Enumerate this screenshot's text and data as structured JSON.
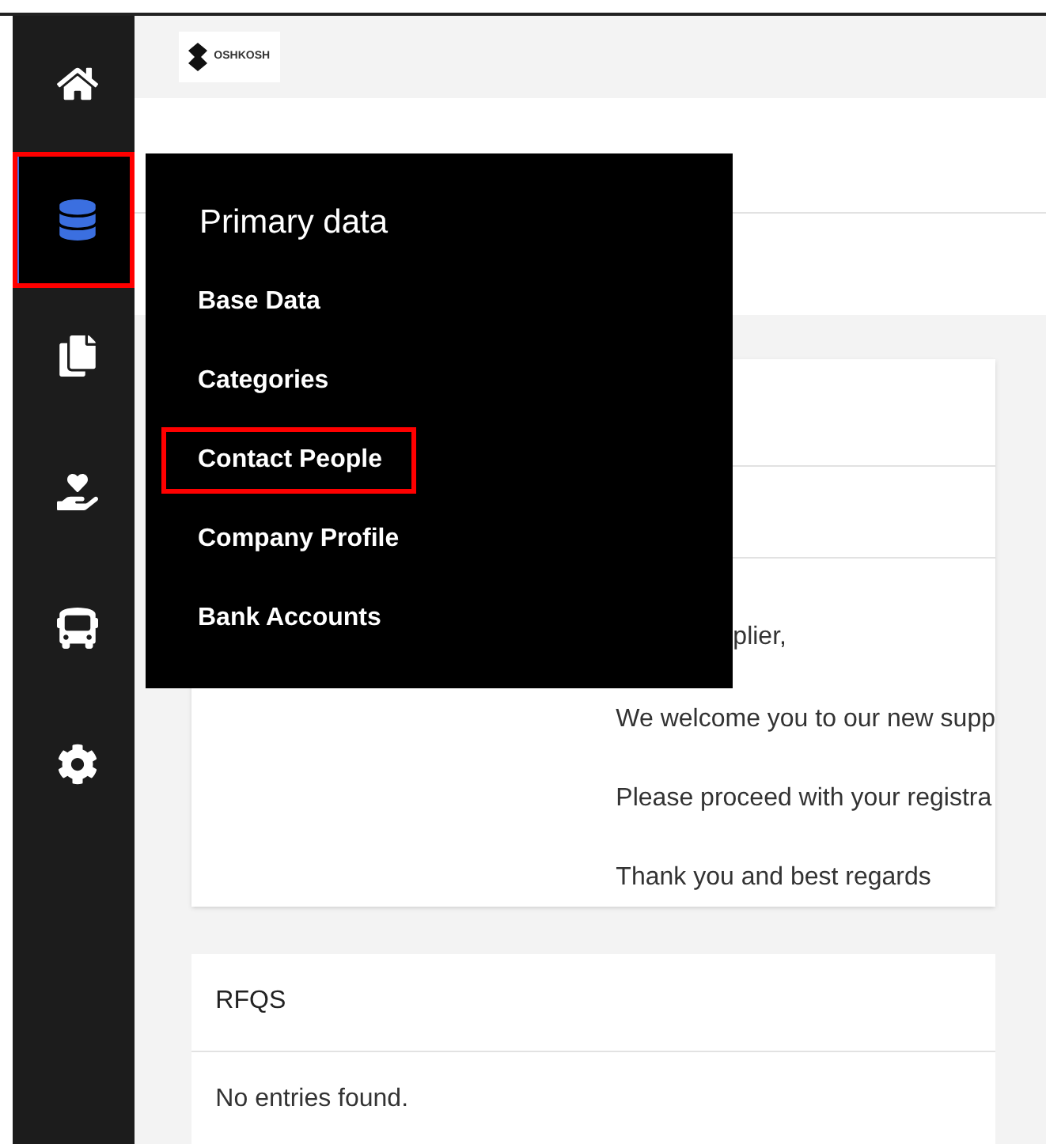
{
  "sidebar": {
    "items": [
      {
        "selected": false,
        "highlighted": false
      },
      {
        "selected": true,
        "highlighted": true
      },
      {
        "selected": false,
        "highlighted": false
      },
      {
        "selected": false,
        "highlighted": false
      },
      {
        "selected": false,
        "highlighted": false
      },
      {
        "selected": false,
        "highlighted": false
      }
    ]
  },
  "header": {
    "logo_text": "OSHKOSH"
  },
  "welcome_card": {
    "greeting": "plier,",
    "lines": [
      "We welcome you to our new supp",
      "Please proceed with your registra",
      "Thank you and best regards"
    ]
  },
  "rfqs_card": {
    "title": "RFQS",
    "empty_text": "No entries found."
  },
  "flyout_menu": {
    "title": "Primary data",
    "items": [
      {
        "label": "Base Data",
        "highlighted": false
      },
      {
        "label": "Categories",
        "highlighted": false
      },
      {
        "label": "Contact People",
        "highlighted": true
      },
      {
        "label": "Company Profile",
        "highlighted": false
      },
      {
        "label": "Bank Accounts",
        "highlighted": false
      }
    ]
  }
}
